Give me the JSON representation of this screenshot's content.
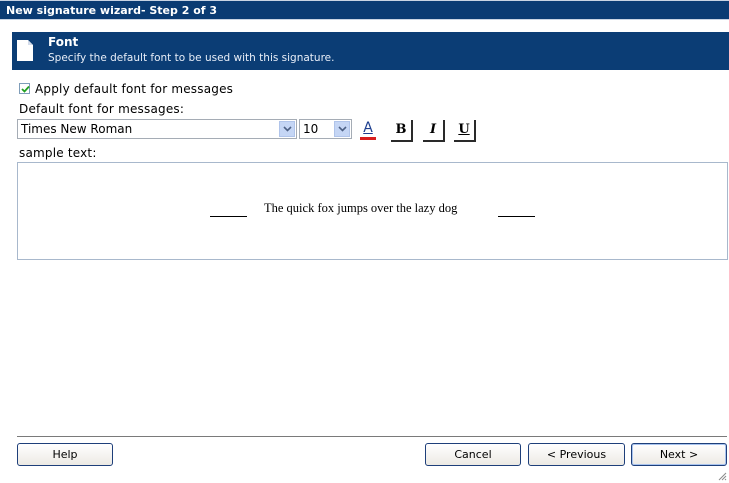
{
  "window": {
    "title": "New signature wizard- Step 2 of 3"
  },
  "header": {
    "title": "Font",
    "subtitle": "Specify the default font to be used with this signature.",
    "icon": "document-icon"
  },
  "form": {
    "apply_default_label": "Apply default font for messages",
    "apply_default_checked": true,
    "default_font_label": "Default font for messages:",
    "font_name": "Times New Roman",
    "font_size": "10",
    "toolbar": {
      "color_glyph": "A",
      "bold_glyph": "B",
      "italic_glyph": "I",
      "underline_glyph": "U"
    },
    "sample_label": "sample text:",
    "sample_text": "The quick fox jumps over the lazy dog"
  },
  "footer": {
    "help": "Help",
    "cancel": "Cancel",
    "previous": "< Previous",
    "next": "Next >"
  },
  "colors": {
    "title_bar": "#0a3b73",
    "header": "#0b3d75",
    "accent_red": "#d81e1e"
  }
}
